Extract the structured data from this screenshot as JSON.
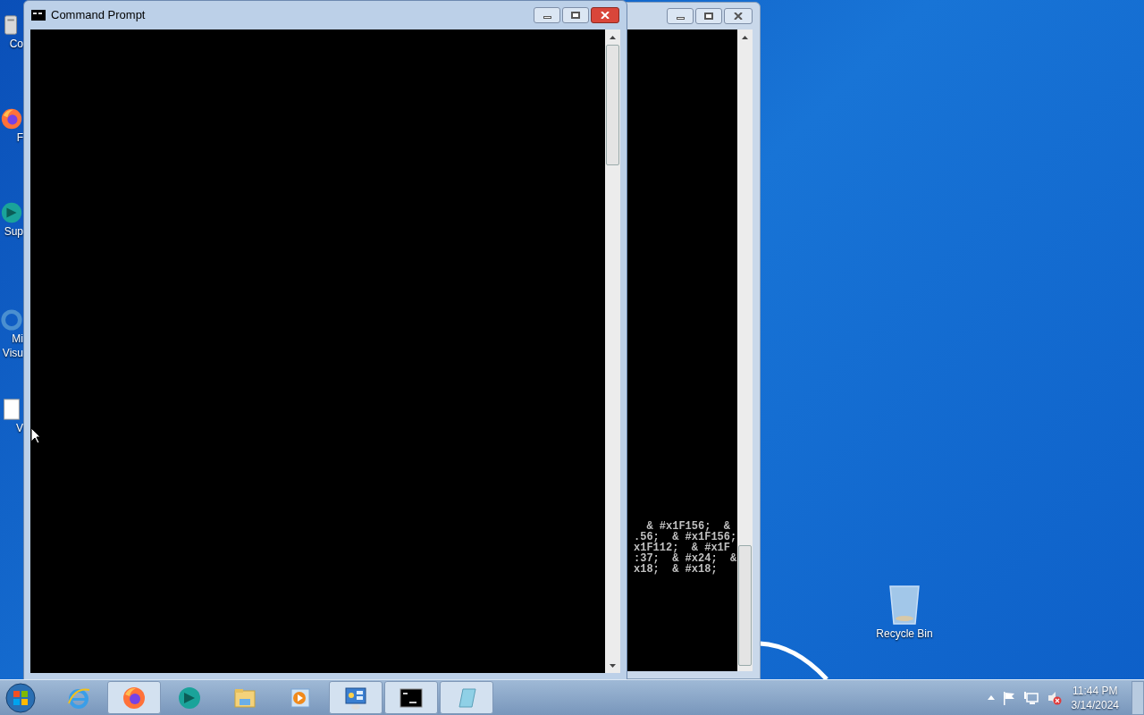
{
  "desktop_icons": [
    {
      "label": "Co",
      "kind": "computer"
    },
    {
      "label": "F",
      "kind": "firefox"
    },
    {
      "label": "Sup",
      "kind": "globe"
    },
    {
      "label": "Mi\nVisu",
      "kind": "studio"
    },
    {
      "label": "V",
      "kind": "document"
    }
  ],
  "recycle_bin": {
    "label": "Recycle Bin"
  },
  "front_window": {
    "title": "Command Prompt"
  },
  "back_window": {
    "lines": [
      "  & #x1F156;  &",
      ".56;  & #x1F156;",
      "x1F112;  & #x1F",
      ":37;  & #x24;  &",
      "x18;  & #x18;"
    ]
  },
  "taskbar": {
    "items": [
      {
        "kind": "ie",
        "running": false
      },
      {
        "kind": "firefox",
        "running": true
      },
      {
        "kind": "globe",
        "running": false
      },
      {
        "kind": "folder",
        "running": false
      },
      {
        "kind": "media",
        "running": false
      },
      {
        "kind": "control",
        "running": true
      },
      {
        "kind": "cmd",
        "running": true
      },
      {
        "kind": "notepad",
        "running": true
      }
    ],
    "time": "11:44 PM",
    "date": "3/14/2024"
  }
}
